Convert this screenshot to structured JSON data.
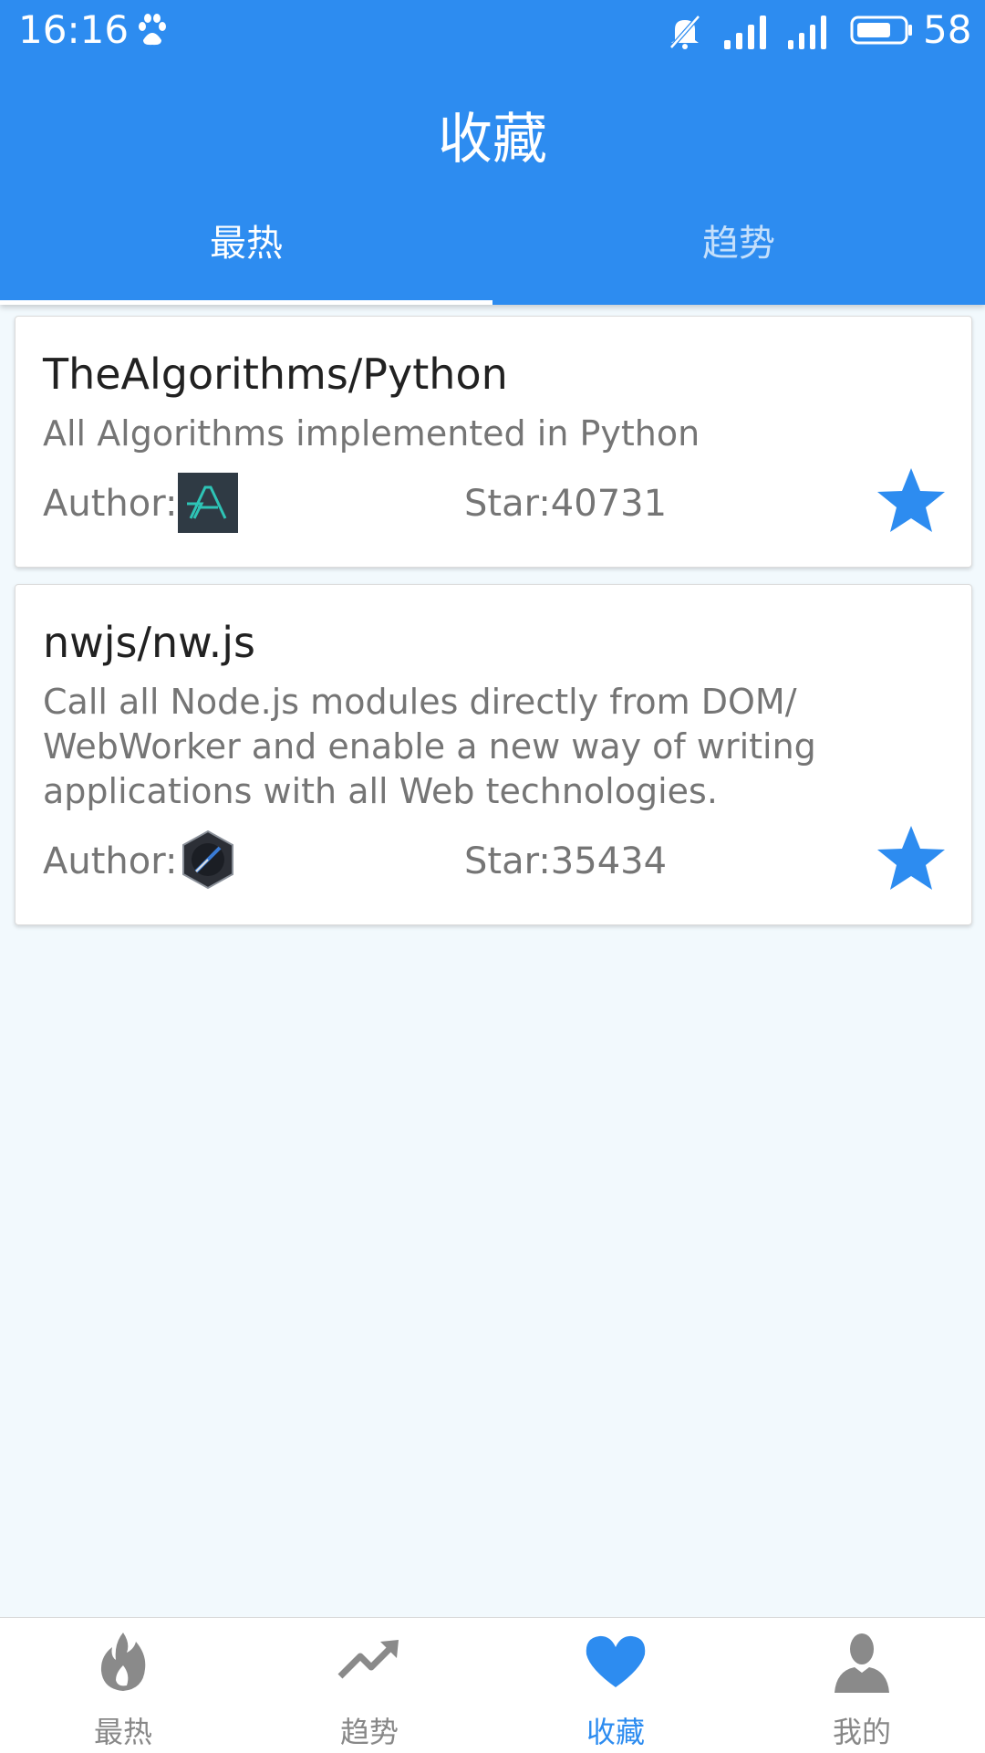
{
  "status_bar": {
    "time": "16:16",
    "battery_level": "58"
  },
  "header": {
    "title": "收藏",
    "tabs": [
      {
        "label": "最热",
        "active": true
      },
      {
        "label": "趋势",
        "active": false
      }
    ]
  },
  "repos": [
    {
      "name": "TheAlgorithms/Python",
      "description": "All Algorithms implemented in Python",
      "author_label": "Author:",
      "stars": "Star:40731",
      "favorited": true
    },
    {
      "name": "nwjs/nw.js",
      "description": "Call all Node.js modules directly from DOM/ WebWorker and enable a new way of writing applications with all Web technologies.",
      "author_label": "Author:",
      "stars": "Star:35434",
      "favorited": true
    }
  ],
  "bottom_nav": [
    {
      "label": "最热",
      "icon": "flame-icon",
      "active": false
    },
    {
      "label": "趋势",
      "icon": "trending-icon",
      "active": false
    },
    {
      "label": "收藏",
      "icon": "heart-icon",
      "active": true
    },
    {
      "label": "我的",
      "icon": "person-icon",
      "active": false
    }
  ],
  "colors": {
    "primary": "#2d8cf0",
    "background": "#f2f9fd"
  }
}
